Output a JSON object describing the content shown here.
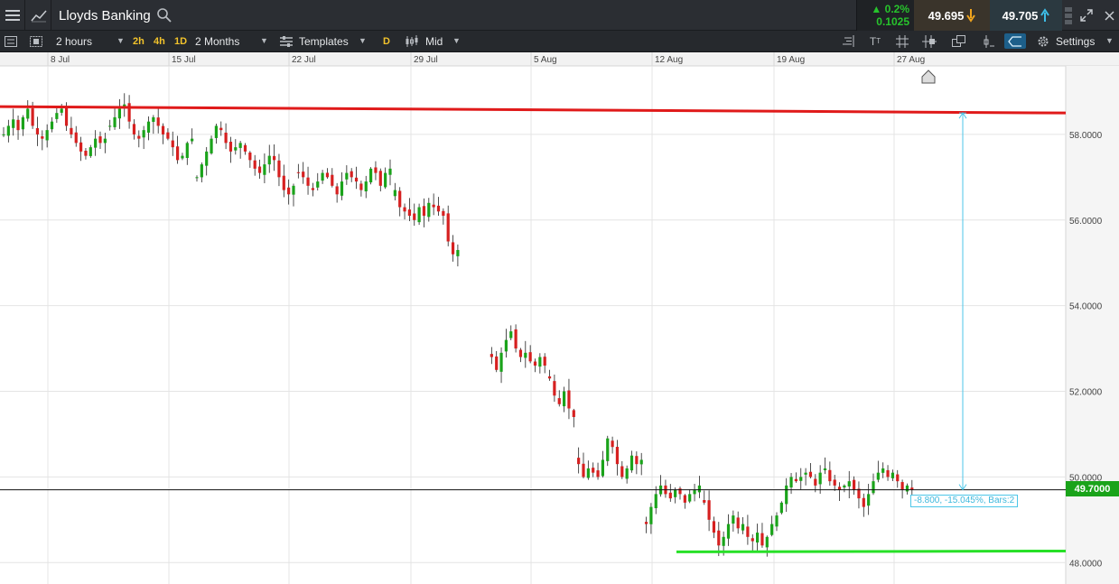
{
  "header": {
    "instrument": "Lloyds Banking",
    "change_pct": "0.2%",
    "change_abs": "0.1025",
    "sell_price": "49.695",
    "buy_price": "49.705"
  },
  "toolbar": {
    "interval": "2 hours",
    "quick_intervals": [
      "2h",
      "4h",
      "1D"
    ],
    "range": "2 Months",
    "templates": "Templates",
    "day_marker": "D",
    "price_type": "Mid",
    "settings": "Settings"
  },
  "icons": {
    "menu": "hamburger-icon",
    "chart_type": "line-chart-icon",
    "search": "search-icon",
    "expand": "expand-icon",
    "close": "close-icon"
  },
  "colors": {
    "up": "#1aa31a",
    "down": "#d62020",
    "resistance": "#e01a1a",
    "support": "#27e027",
    "measure": "#4cc6e8"
  },
  "chart": {
    "price_tag": "49.7000",
    "measure_label": "-8.800, -15.045%, Bars:2"
  },
  "chart_data": {
    "type": "candlestick",
    "x_tick_labels": [
      "8 Jul",
      "15 Jul",
      "22 Jul",
      "29 Jul",
      "5 Aug",
      "12 Aug",
      "19 Aug",
      "27 Aug"
    ],
    "y_tick_labels": [
      "58.0000",
      "56.0000",
      "54.0000",
      "52.0000",
      "50.0000",
      "48.0000"
    ],
    "ylim": [
      47.5,
      59.6
    ],
    "current_price": 49.7,
    "resistance_line": {
      "start": 58.65,
      "end": 58.5
    },
    "support_line": {
      "start": 48.25,
      "end": 48.27
    },
    "measure": {
      "from": 58.5,
      "to": 49.7
    },
    "sessions": [
      {
        "start": 0,
        "closes": [
          58.0,
          58.2,
          58.35,
          58.1,
          58.4,
          58.6,
          58.2,
          58.0,
          57.9,
          58.1,
          58.3,
          58.5,
          58.6,
          58.2,
          58.0,
          57.8,
          57.6,
          57.5,
          57.7,
          57.9,
          57.8,
          57.9
        ]
      },
      {
        "start": 22,
        "closes": [
          58.2,
          58.4,
          58.6,
          58.7,
          58.3,
          58.0,
          57.9,
          58.1,
          58.3,
          58.4,
          58.2,
          58.0,
          57.9,
          57.7,
          57.4,
          57.5,
          57.8,
          57.9
        ]
      },
      {
        "start": 40,
        "closes": [
          57.0,
          57.3,
          57.6,
          57.9,
          58.2,
          58.1,
          57.8,
          57.6,
          57.7,
          57.8,
          57.6,
          57.4,
          57.2,
          57.1,
          57.3,
          57.5,
          57.4,
          57.0,
          56.7,
          56.6,
          56.8
        ]
      },
      {
        "start": 61,
        "closes": [
          57.1,
          57.0,
          56.8,
          56.7,
          56.9,
          57.1,
          57.0,
          56.8,
          56.6,
          56.9,
          57.1,
          57.0,
          56.9,
          56.7,
          56.9,
          57.2,
          57.1,
          56.8,
          57.1,
          57.2
        ]
      },
      {
        "start": 81,
        "closes": [
          56.7,
          56.3,
          56.2,
          56.1,
          56.0,
          56.3,
          56.1,
          56.4,
          56.3,
          56.2,
          56.1,
          55.5,
          55.2,
          55.3
        ]
      },
      {
        "start": 101,
        "closes": [
          52.8,
          52.5,
          52.9,
          53.2,
          53.4,
          53.0,
          52.8,
          52.9,
          52.7,
          52.6,
          52.8,
          52.6
        ]
      },
      {
        "start": 113,
        "closes": [
          52.3,
          51.9,
          51.7,
          52.0,
          51.6,
          51.4
        ]
      },
      {
        "start": 119,
        "closes": [
          50.3,
          50.0,
          50.2,
          50.1,
          50.0,
          50.4,
          50.9,
          50.7,
          50.3,
          50.0,
          50.2,
          50.5,
          50.3,
          50.4
        ]
      },
      {
        "start": 133,
        "closes": [
          48.9,
          49.3,
          49.6,
          49.8,
          49.6,
          49.5,
          49.7,
          49.6,
          49.4,
          49.6,
          49.7,
          49.8
        ]
      },
      {
        "start": 145,
        "closes": [
          49.4,
          49.0,
          48.7,
          48.4,
          48.6,
          48.9,
          49.1,
          48.8,
          48.9,
          48.6,
          48.5,
          48.7,
          48.4,
          48.6,
          48.9,
          49.1,
          49.4,
          49.8,
          50.0,
          49.9,
          50.0,
          50.1,
          50.0,
          49.8,
          50.1,
          50.2,
          49.9,
          49.8,
          49.7,
          49.8,
          49.9,
          49.7,
          49.5,
          49.3,
          49.6,
          49.9,
          50.1,
          50.2,
          50.0,
          50.1,
          49.9,
          49.7,
          49.8,
          49.7
        ]
      }
    ]
  }
}
